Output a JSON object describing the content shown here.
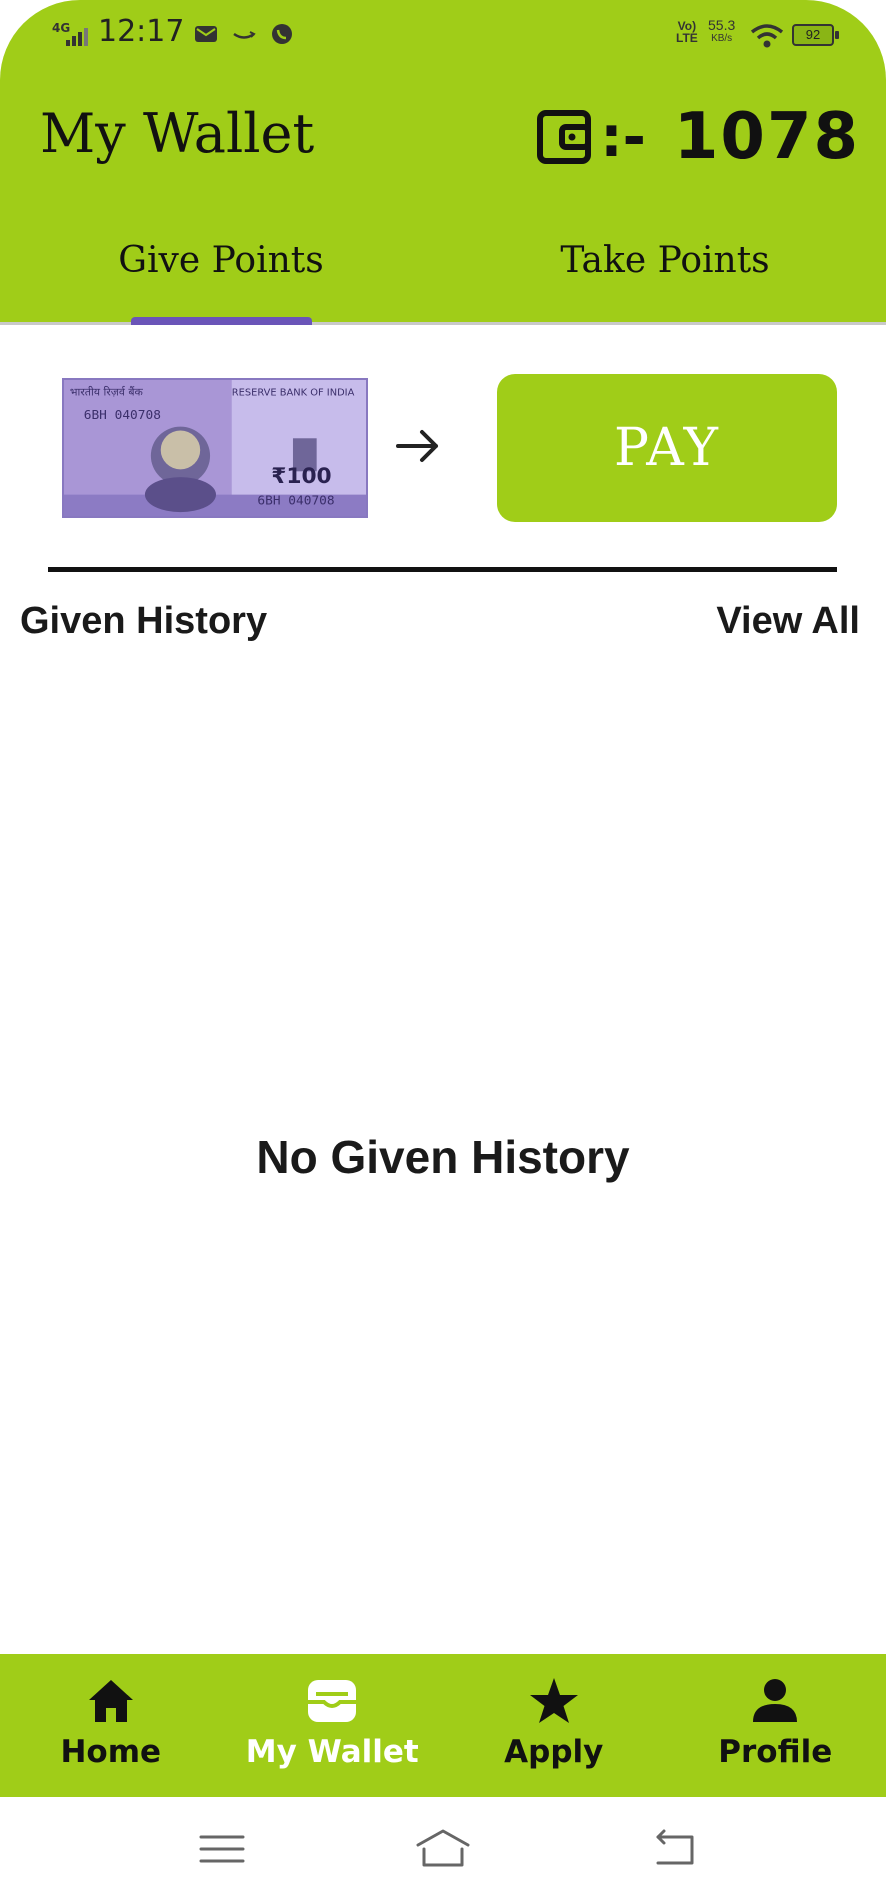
{
  "status_bar": {
    "network": "4G",
    "time": "12:17",
    "volte": "Vo) LTE",
    "speed_value": "55.3",
    "speed_unit": "KB/s",
    "battery": "92"
  },
  "header": {
    "title": "My Wallet",
    "balance_separator": ":-",
    "balance": "1078",
    "wallet_icon": "wallet-icon"
  },
  "tabs": [
    {
      "label": "Give Points",
      "active": true
    },
    {
      "label": "Take Points",
      "active": false
    }
  ],
  "pay_section": {
    "note_header_left": "भारतीय रिज़र्व बैंक",
    "note_header_right": "RESERVE BANK OF INDIA",
    "note_serial": "6BH 040708",
    "note_denomination": "₹100",
    "pay_label": "PAY"
  },
  "history": {
    "title": "Given History",
    "view_all_label": "View All",
    "empty_message": "No Given History"
  },
  "bottom_nav": [
    {
      "label": "Home",
      "icon": "home-icon",
      "active": false
    },
    {
      "label": "My Wallet",
      "icon": "wallet-icon",
      "active": true
    },
    {
      "label": "Apply",
      "icon": "star-icon",
      "active": false
    },
    {
      "label": "Profile",
      "icon": "person-icon",
      "active": false
    }
  ],
  "colors": {
    "brand_green": "#a0cd18",
    "tab_indicator": "#6a55b8",
    "note_purple": "#b6a6dd"
  }
}
